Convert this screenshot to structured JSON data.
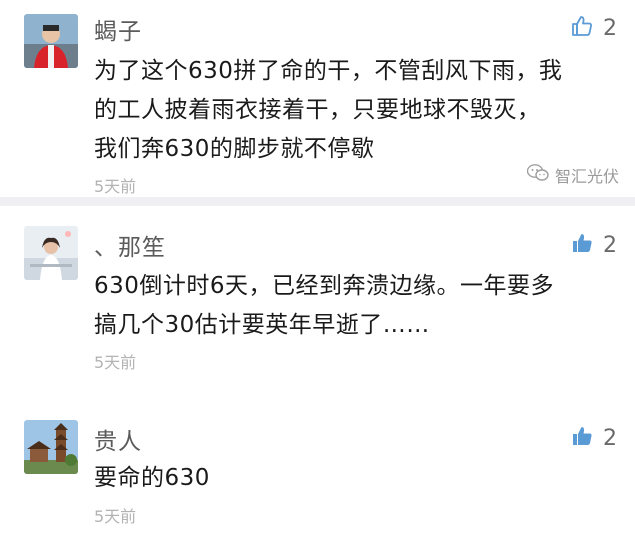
{
  "comments": [
    {
      "author": "蝎子",
      "like_count": "2",
      "lines": [
        "为了这个630拼了命的干，不管刮风下雨，我",
        "的工人披着雨衣接着干，只要地球不毁灭，",
        "我们奔630的脚步就不停歇"
      ],
      "time": "5天前",
      "liked": false
    },
    {
      "author": "、那笙",
      "like_count": "2",
      "lines": [
        "630倒计时6天，已经到奔溃边缘。一年要多",
        "搞几个30估计要英年早逝了……"
      ],
      "time": "5天前",
      "liked": true
    },
    {
      "author": "贵人",
      "like_count": "2",
      "lines": [
        "要命的630"
      ],
      "time": "5天前",
      "liked": true
    }
  ],
  "watermark": {
    "text": "智汇光伏"
  },
  "colors": {
    "background": "#efeff4",
    "card": "#ffffff",
    "like_filled": "#5b9bd5",
    "like_outline": "#5b9bd5"
  }
}
